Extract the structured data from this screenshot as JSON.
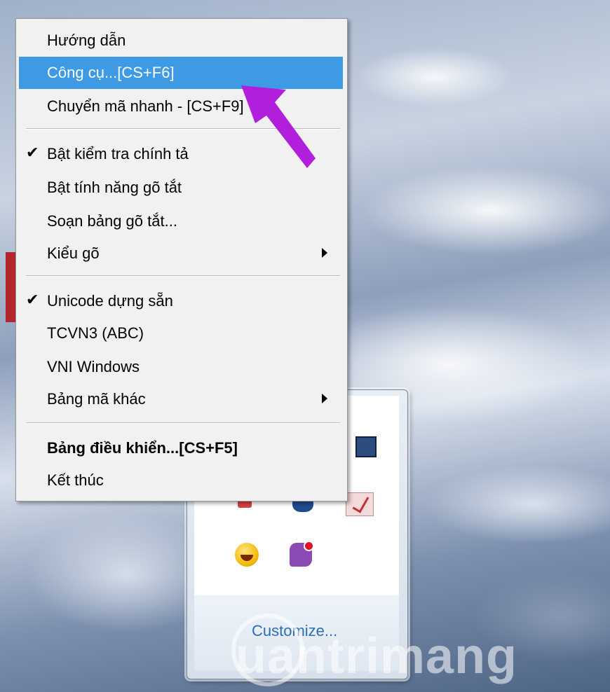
{
  "context_menu": {
    "items": [
      {
        "label": "Hướng dẫn"
      },
      {
        "label": "Công cụ...[CS+F6]"
      },
      {
        "label": "Chuyển mã nhanh - [CS+F9]"
      },
      {
        "label": "Bật kiểm tra chính tả",
        "checked": true
      },
      {
        "label": "Bật tính năng gõ tắt"
      },
      {
        "label": "Soạn bảng gõ tắt..."
      },
      {
        "label": "Kiểu gõ",
        "submenu": true
      },
      {
        "label": "Unicode dựng sẵn",
        "checked": true
      },
      {
        "label": "TCVN3 (ABC)"
      },
      {
        "label": "VNI Windows"
      },
      {
        "label": "Bảng mã khác",
        "submenu": true
      },
      {
        "label": "Bảng điều khiển...[CS+F5]",
        "bold": true
      },
      {
        "label": "Kết thúc"
      }
    ],
    "check_glyph": "✔",
    "highlight_color": "#3f9ae6"
  },
  "tray_popup": {
    "customize_label": "Customize...",
    "icons": [
      "monitor-icon",
      "red-icon",
      "blue-icon",
      "check-icon",
      "yahoo-messenger-icon",
      "viber-icon"
    ]
  },
  "annotation": {
    "arrow_color": "#b21fdc"
  },
  "watermark": {
    "text": "uantrimang"
  }
}
